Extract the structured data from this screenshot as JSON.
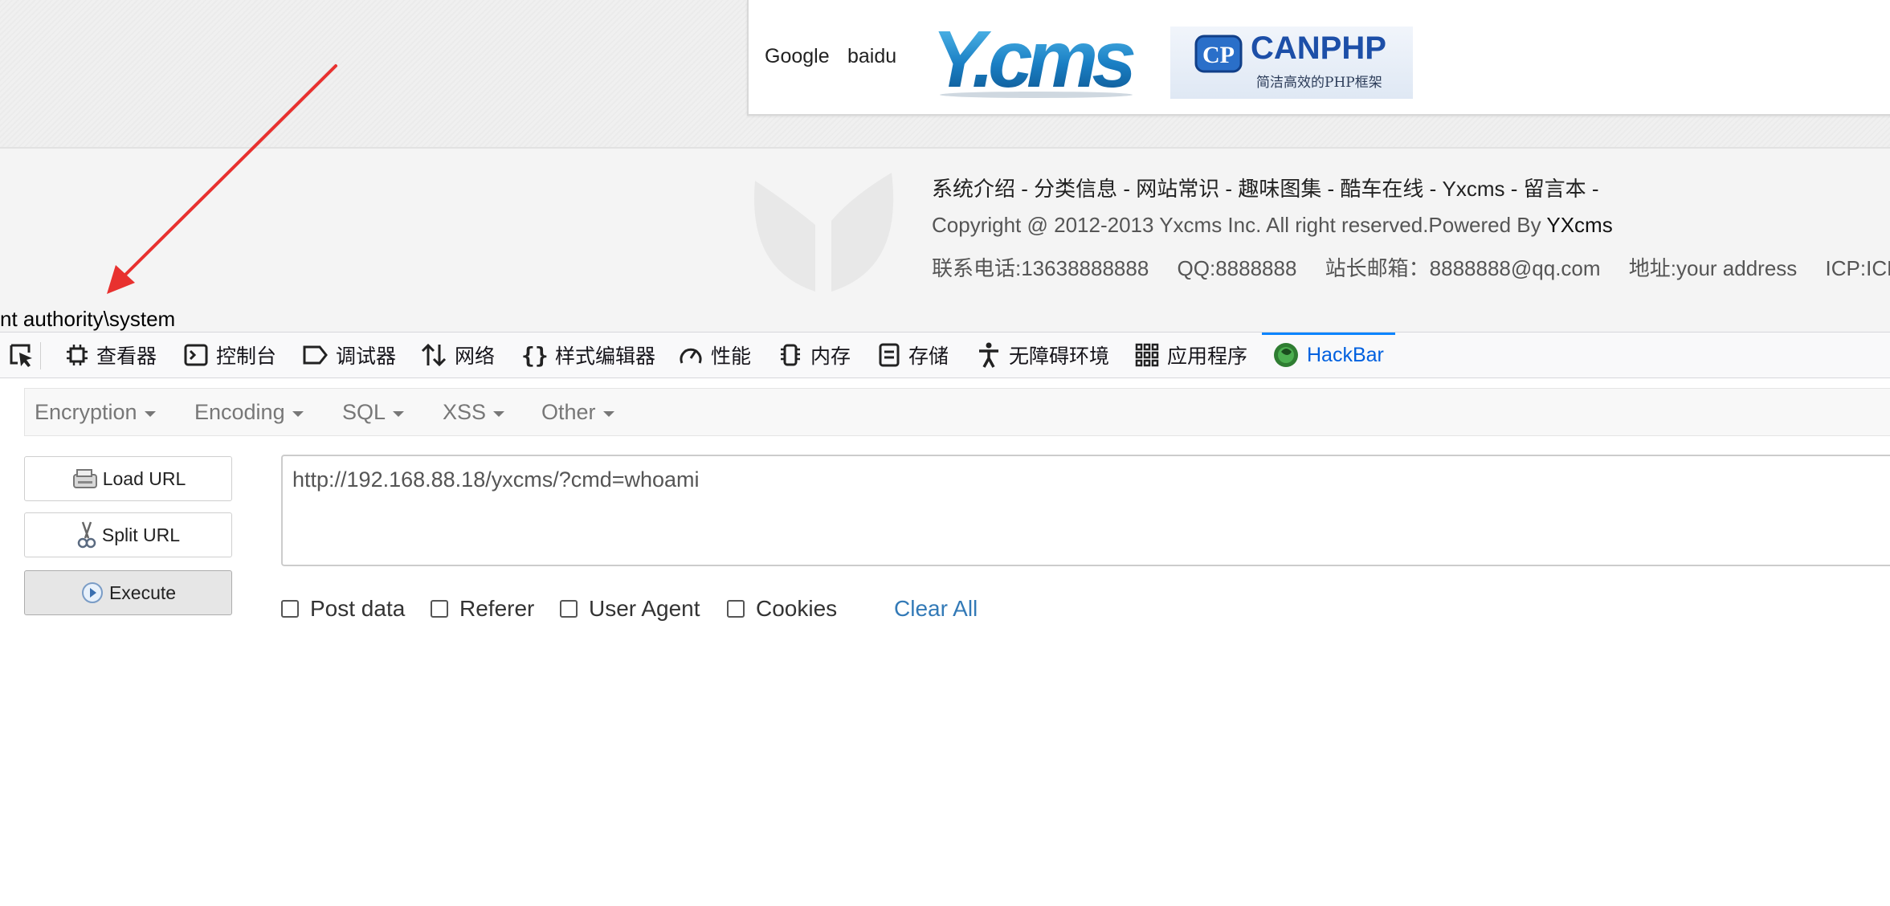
{
  "page": {
    "friend_links": [
      "Google",
      "baidu"
    ],
    "logo_ycms": "Y.cms",
    "logo_canphp": {
      "badge": "CP",
      "name": "CANPHP",
      "tagline": "简洁高效的PHP框架"
    },
    "footer": {
      "nav": "系统介绍 - 分类信息 - 网站常识 - 趣味图集 - 酷车在线 - Yxcms - 留言本 -",
      "copyright": "Copyright @ 2012-2013 Yxcms Inc. All right reserved.Powered By ",
      "powered_brand": "YXcms",
      "contact": [
        "联系电话:13638888888",
        "QQ:8888888",
        "站长邮箱：8888888@qq.com",
        "地址:your address",
        "ICP:ICPx"
      ]
    },
    "command_output": "nt authority\\system",
    "annotation_color": "#e8312f"
  },
  "devtools": {
    "tabs": [
      {
        "label": "查看器",
        "icon": "inspector-icon"
      },
      {
        "label": "控制台",
        "icon": "console-icon"
      },
      {
        "label": "调试器",
        "icon": "debugger-icon"
      },
      {
        "label": "网络",
        "icon": "network-icon"
      },
      {
        "label": "样式编辑器",
        "icon": "style-editor-icon"
      },
      {
        "label": "性能",
        "icon": "performance-icon"
      },
      {
        "label": "内存",
        "icon": "memory-icon"
      },
      {
        "label": "存储",
        "icon": "storage-icon"
      },
      {
        "label": "无障碍环境",
        "icon": "accessibility-icon"
      },
      {
        "label": "应用程序",
        "icon": "application-icon"
      },
      {
        "label": "HackBar",
        "icon": "hackbar-icon",
        "active": true
      }
    ]
  },
  "hackbar": {
    "menu": [
      "Encryption",
      "Encoding",
      "SQL",
      "XSS",
      "Other"
    ],
    "buttons": {
      "load": "Load URL",
      "split": "Split URL",
      "execute": "Execute"
    },
    "url_value": "http://192.168.88.18/yxcms/?cmd=whoami",
    "options": [
      "Post data",
      "Referer",
      "User Agent",
      "Cookies"
    ],
    "clear_all": "Clear All"
  }
}
